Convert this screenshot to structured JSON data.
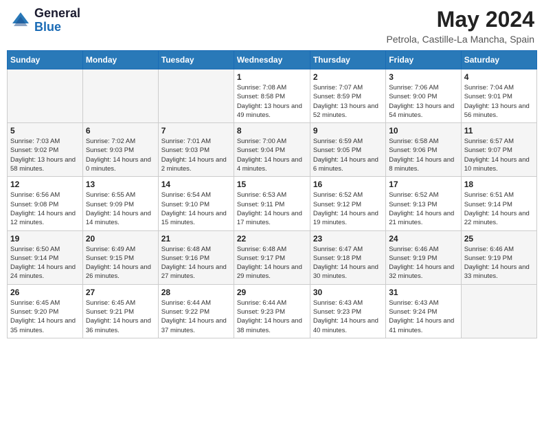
{
  "header": {
    "logo": {
      "general": "General",
      "blue": "Blue"
    },
    "title": "May 2024",
    "location": "Petrola, Castille-La Mancha, Spain"
  },
  "days_of_week": [
    "Sunday",
    "Monday",
    "Tuesday",
    "Wednesday",
    "Thursday",
    "Friday",
    "Saturday"
  ],
  "weeks": [
    [
      {
        "day": "",
        "sunrise": "",
        "sunset": "",
        "daylight": ""
      },
      {
        "day": "",
        "sunrise": "",
        "sunset": "",
        "daylight": ""
      },
      {
        "day": "",
        "sunrise": "",
        "sunset": "",
        "daylight": ""
      },
      {
        "day": "1",
        "sunrise": "Sunrise: 7:08 AM",
        "sunset": "Sunset: 8:58 PM",
        "daylight": "Daylight: 13 hours and 49 minutes."
      },
      {
        "day": "2",
        "sunrise": "Sunrise: 7:07 AM",
        "sunset": "Sunset: 8:59 PM",
        "daylight": "Daylight: 13 hours and 52 minutes."
      },
      {
        "day": "3",
        "sunrise": "Sunrise: 7:06 AM",
        "sunset": "Sunset: 9:00 PM",
        "daylight": "Daylight: 13 hours and 54 minutes."
      },
      {
        "day": "4",
        "sunrise": "Sunrise: 7:04 AM",
        "sunset": "Sunset: 9:01 PM",
        "daylight": "Daylight: 13 hours and 56 minutes."
      }
    ],
    [
      {
        "day": "5",
        "sunrise": "Sunrise: 7:03 AM",
        "sunset": "Sunset: 9:02 PM",
        "daylight": "Daylight: 13 hours and 58 minutes."
      },
      {
        "day": "6",
        "sunrise": "Sunrise: 7:02 AM",
        "sunset": "Sunset: 9:03 PM",
        "daylight": "Daylight: 14 hours and 0 minutes."
      },
      {
        "day": "7",
        "sunrise": "Sunrise: 7:01 AM",
        "sunset": "Sunset: 9:03 PM",
        "daylight": "Daylight: 14 hours and 2 minutes."
      },
      {
        "day": "8",
        "sunrise": "Sunrise: 7:00 AM",
        "sunset": "Sunset: 9:04 PM",
        "daylight": "Daylight: 14 hours and 4 minutes."
      },
      {
        "day": "9",
        "sunrise": "Sunrise: 6:59 AM",
        "sunset": "Sunset: 9:05 PM",
        "daylight": "Daylight: 14 hours and 6 minutes."
      },
      {
        "day": "10",
        "sunrise": "Sunrise: 6:58 AM",
        "sunset": "Sunset: 9:06 PM",
        "daylight": "Daylight: 14 hours and 8 minutes."
      },
      {
        "day": "11",
        "sunrise": "Sunrise: 6:57 AM",
        "sunset": "Sunset: 9:07 PM",
        "daylight": "Daylight: 14 hours and 10 minutes."
      }
    ],
    [
      {
        "day": "12",
        "sunrise": "Sunrise: 6:56 AM",
        "sunset": "Sunset: 9:08 PM",
        "daylight": "Daylight: 14 hours and 12 minutes."
      },
      {
        "day": "13",
        "sunrise": "Sunrise: 6:55 AM",
        "sunset": "Sunset: 9:09 PM",
        "daylight": "Daylight: 14 hours and 14 minutes."
      },
      {
        "day": "14",
        "sunrise": "Sunrise: 6:54 AM",
        "sunset": "Sunset: 9:10 PM",
        "daylight": "Daylight: 14 hours and 15 minutes."
      },
      {
        "day": "15",
        "sunrise": "Sunrise: 6:53 AM",
        "sunset": "Sunset: 9:11 PM",
        "daylight": "Daylight: 14 hours and 17 minutes."
      },
      {
        "day": "16",
        "sunrise": "Sunrise: 6:52 AM",
        "sunset": "Sunset: 9:12 PM",
        "daylight": "Daylight: 14 hours and 19 minutes."
      },
      {
        "day": "17",
        "sunrise": "Sunrise: 6:52 AM",
        "sunset": "Sunset: 9:13 PM",
        "daylight": "Daylight: 14 hours and 21 minutes."
      },
      {
        "day": "18",
        "sunrise": "Sunrise: 6:51 AM",
        "sunset": "Sunset: 9:14 PM",
        "daylight": "Daylight: 14 hours and 22 minutes."
      }
    ],
    [
      {
        "day": "19",
        "sunrise": "Sunrise: 6:50 AM",
        "sunset": "Sunset: 9:14 PM",
        "daylight": "Daylight: 14 hours and 24 minutes."
      },
      {
        "day": "20",
        "sunrise": "Sunrise: 6:49 AM",
        "sunset": "Sunset: 9:15 PM",
        "daylight": "Daylight: 14 hours and 26 minutes."
      },
      {
        "day": "21",
        "sunrise": "Sunrise: 6:48 AM",
        "sunset": "Sunset: 9:16 PM",
        "daylight": "Daylight: 14 hours and 27 minutes."
      },
      {
        "day": "22",
        "sunrise": "Sunrise: 6:48 AM",
        "sunset": "Sunset: 9:17 PM",
        "daylight": "Daylight: 14 hours and 29 minutes."
      },
      {
        "day": "23",
        "sunrise": "Sunrise: 6:47 AM",
        "sunset": "Sunset: 9:18 PM",
        "daylight": "Daylight: 14 hours and 30 minutes."
      },
      {
        "day": "24",
        "sunrise": "Sunrise: 6:46 AM",
        "sunset": "Sunset: 9:19 PM",
        "daylight": "Daylight: 14 hours and 32 minutes."
      },
      {
        "day": "25",
        "sunrise": "Sunrise: 6:46 AM",
        "sunset": "Sunset: 9:19 PM",
        "daylight": "Daylight: 14 hours and 33 minutes."
      }
    ],
    [
      {
        "day": "26",
        "sunrise": "Sunrise: 6:45 AM",
        "sunset": "Sunset: 9:20 PM",
        "daylight": "Daylight: 14 hours and 35 minutes."
      },
      {
        "day": "27",
        "sunrise": "Sunrise: 6:45 AM",
        "sunset": "Sunset: 9:21 PM",
        "daylight": "Daylight: 14 hours and 36 minutes."
      },
      {
        "day": "28",
        "sunrise": "Sunrise: 6:44 AM",
        "sunset": "Sunset: 9:22 PM",
        "daylight": "Daylight: 14 hours and 37 minutes."
      },
      {
        "day": "29",
        "sunrise": "Sunrise: 6:44 AM",
        "sunset": "Sunset: 9:23 PM",
        "daylight": "Daylight: 14 hours and 38 minutes."
      },
      {
        "day": "30",
        "sunrise": "Sunrise: 6:43 AM",
        "sunset": "Sunset: 9:23 PM",
        "daylight": "Daylight: 14 hours and 40 minutes."
      },
      {
        "day": "31",
        "sunrise": "Sunrise: 6:43 AM",
        "sunset": "Sunset: 9:24 PM",
        "daylight": "Daylight: 14 hours and 41 minutes."
      },
      {
        "day": "",
        "sunrise": "",
        "sunset": "",
        "daylight": ""
      }
    ]
  ]
}
